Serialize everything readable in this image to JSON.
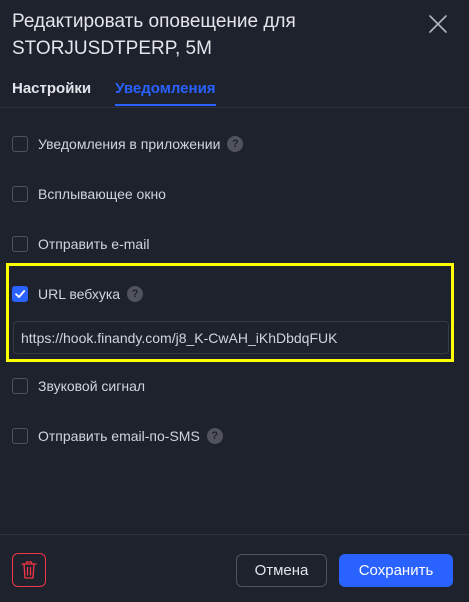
{
  "header": {
    "title": "Редактировать оповещение для STORJUSDTPERP, 5M"
  },
  "tabs": [
    {
      "label": "Настройки",
      "active": false
    },
    {
      "label": "Уведомления",
      "active": true
    }
  ],
  "options": [
    {
      "label": "Уведомления в приложении",
      "checked": false,
      "help": "?"
    },
    {
      "label": "Всплывающее окно",
      "checked": false
    },
    {
      "label": "Отправить e-mail",
      "checked": false
    },
    {
      "label": "URL вебхука",
      "checked": true,
      "help": "?"
    },
    {
      "label": "Звуковой сигнал",
      "checked": false
    },
    {
      "label": "Отправить email-по-SMS",
      "checked": false,
      "help": "?"
    }
  ],
  "webhook": {
    "value": "https://hook.finandy.com/j8_K-CwAH_iKhDbdqFUK"
  },
  "footer": {
    "cancel_label": "Отмена",
    "save_label": "Сохранить"
  },
  "colors": {
    "background": "#1e222d",
    "accent": "#2962ff",
    "danger": "#f23645",
    "highlight": "#ffff00"
  },
  "icons": {
    "close": "close-icon",
    "delete": "trash-icon",
    "help": "question-icon",
    "check": "checkmark-icon"
  }
}
